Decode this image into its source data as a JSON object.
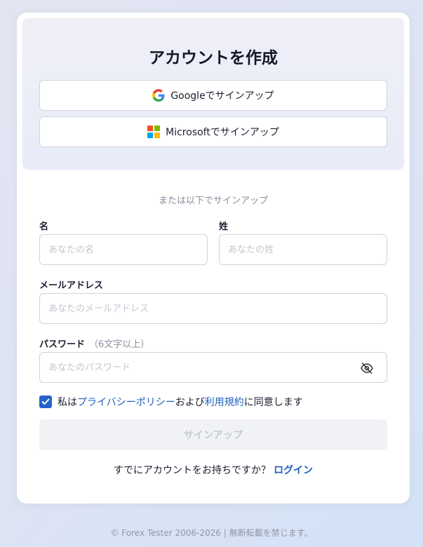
{
  "title": "アカウントを作成",
  "oauth": {
    "google_label": "Googleでサインアップ",
    "microsoft_label": "Microsoftでサインアップ"
  },
  "divider": "または以下でサインアップ",
  "fields": {
    "first_name": {
      "label": "名",
      "placeholder": "あなたの名",
      "value": ""
    },
    "last_name": {
      "label": "姓",
      "placeholder": "あなたの姓",
      "value": ""
    },
    "email": {
      "label": "メールアドレス",
      "placeholder": "あなたのメールアドレス",
      "value": ""
    },
    "password": {
      "label": "パスワード",
      "hint": "（6文字以上）",
      "placeholder": "あなたのパスワード",
      "value": ""
    }
  },
  "consent": {
    "checked": true,
    "prefix": "私は",
    "privacy_link": "プライバシーポリシー",
    "middle": "および",
    "terms_link": "利用規約",
    "suffix": "に同意します"
  },
  "submit_label": "サインアップ",
  "login": {
    "question": "すでにアカウントをお持ちですか？",
    "link": "ログイン"
  },
  "footer": "© Forex Tester 2006-2026 | 無断転載を禁じます。",
  "colors": {
    "accent": "#2563c9",
    "link": "#1f5fbf",
    "ms_red": "#f25022",
    "ms_green": "#7fba00",
    "ms_blue": "#00a4ef",
    "ms_yellow": "#ffb900"
  },
  "icons": {
    "google": "google-logo-icon",
    "microsoft": "microsoft-logo-icon",
    "password_toggle": "eye-slash-icon",
    "checkbox": "checkmark-icon"
  }
}
